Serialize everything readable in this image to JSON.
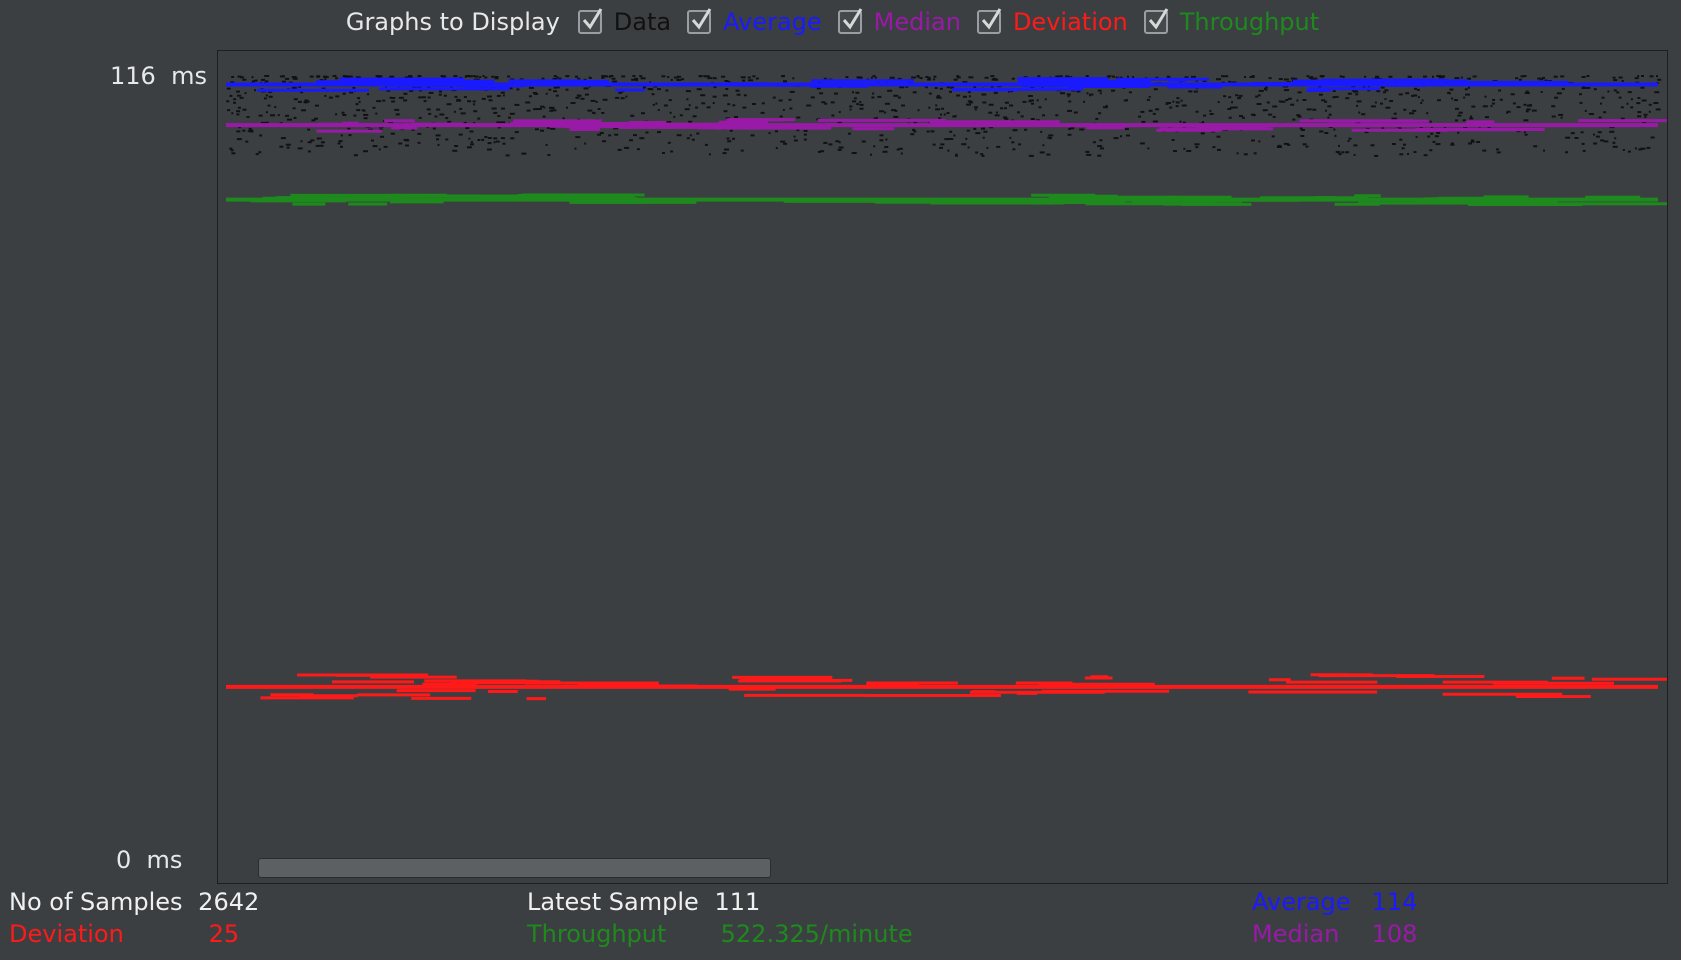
{
  "legend": {
    "title": "Graphs to Display",
    "items": [
      {
        "label": "Data",
        "color": "#111111",
        "checked": true
      },
      {
        "label": "Average",
        "color": "#1a1aff",
        "checked": true
      },
      {
        "label": "Median",
        "color": "#9a1aa8",
        "checked": true
      },
      {
        "label": "Deviation",
        "color": "#ff1a1a",
        "checked": true
      },
      {
        "label": "Throughput",
        "color": "#1e8a1e",
        "checked": true
      }
    ]
  },
  "axis": {
    "y_max_label": "116",
    "y_min_label": "0",
    "unit": "ms"
  },
  "stats": {
    "samples_label": "No of Samples",
    "samples_value": "2642",
    "latest_label": "Latest Sample",
    "latest_value": "111",
    "average_label": "Average",
    "average_value": "114",
    "deviation_label": "Deviation",
    "deviation_value": "25",
    "throughput_label": "Throughput",
    "throughput_value": "522.325/minute",
    "median_label": "Median",
    "median_value": "108"
  },
  "chart_data": {
    "type": "line",
    "ylim": [
      0,
      116
    ],
    "series": [
      {
        "name": "Average",
        "level": 114
      },
      {
        "name": "Median",
        "level": 108
      },
      {
        "name": "Deviation",
        "level": 25
      },
      {
        "name": "Throughput",
        "level": 97
      }
    ]
  }
}
